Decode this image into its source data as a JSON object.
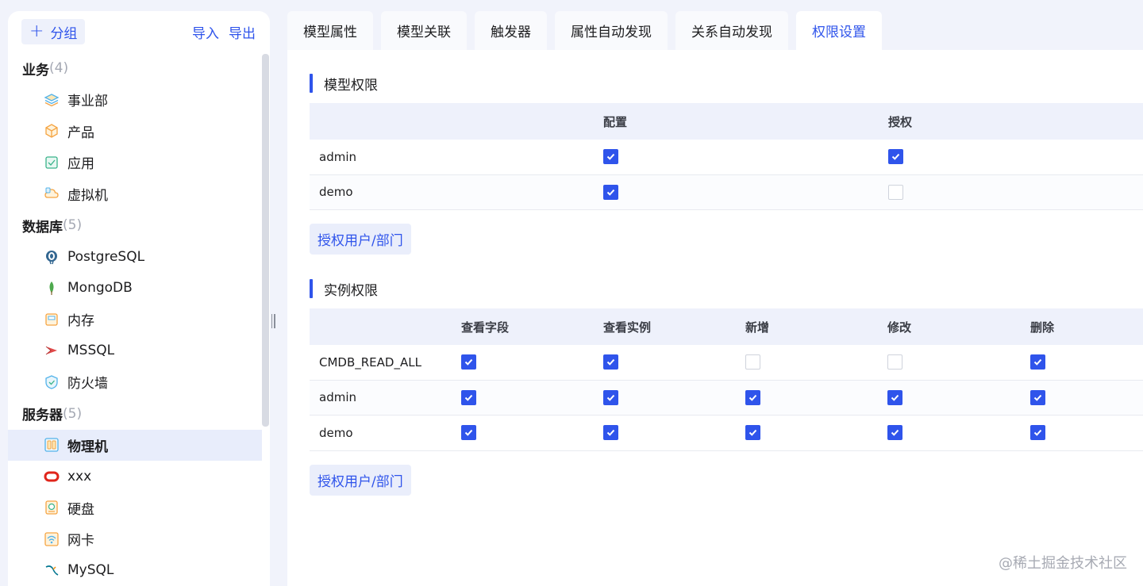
{
  "sidebar": {
    "add_group_label": "分组",
    "import_label": "导入",
    "export_label": "导出",
    "groups": [
      {
        "name": "业务",
        "count": "(4)",
        "items": [
          {
            "label": "事业部",
            "icon": "layers-icon"
          },
          {
            "label": "产品",
            "icon": "cube-icon"
          },
          {
            "label": "应用",
            "icon": "app-window-icon"
          },
          {
            "label": "虚拟机",
            "icon": "cloud-icon"
          }
        ]
      },
      {
        "name": "数据库",
        "count": "(5)",
        "items": [
          {
            "label": "PostgreSQL",
            "icon": "postgresql-icon"
          },
          {
            "label": "MongoDB",
            "icon": "mongodb-leaf-icon"
          },
          {
            "label": "内存",
            "icon": "memory-icon"
          },
          {
            "label": "MSSQL",
            "icon": "mssql-icon"
          },
          {
            "label": "防火墙",
            "icon": "shield-icon"
          }
        ]
      },
      {
        "name": "服务器",
        "count": "(5)",
        "items": [
          {
            "label": "物理机",
            "icon": "server-icon",
            "active": true
          },
          {
            "label": "xxx",
            "icon": "oracle-ring-icon"
          },
          {
            "label": "硬盘",
            "icon": "disk-icon"
          },
          {
            "label": "网卡",
            "icon": "wifi-card-icon"
          },
          {
            "label": "MySQL",
            "icon": "mysql-dolphin-icon"
          }
        ]
      }
    ]
  },
  "tabs": [
    {
      "label": "模型属性"
    },
    {
      "label": "模型关联"
    },
    {
      "label": "触发器"
    },
    {
      "label": "属性自动发现"
    },
    {
      "label": "关系自动发现"
    },
    {
      "label": "权限设置",
      "active": true
    }
  ],
  "model_permissions": {
    "title": "模型权限",
    "columns": [
      "配置",
      "授权"
    ],
    "rows": [
      {
        "name": "admin",
        "values": [
          true,
          true
        ]
      },
      {
        "name": "demo",
        "values": [
          true,
          false
        ]
      }
    ],
    "grant_button": "授权用户/部门"
  },
  "instance_permissions": {
    "title": "实例权限",
    "columns": [
      "查看字段",
      "查看实例",
      "新增",
      "修改",
      "删除"
    ],
    "rows": [
      {
        "name": "CMDB_READ_ALL",
        "values": [
          true,
          true,
          false,
          false,
          true
        ]
      },
      {
        "name": "admin",
        "values": [
          true,
          true,
          true,
          true,
          true
        ]
      },
      {
        "name": "demo",
        "values": [
          true,
          true,
          true,
          true,
          true
        ]
      }
    ],
    "grant_button": "授权用户/部门"
  },
  "watermark": "@稀土掘金技术社区",
  "colors": {
    "accent": "#2f54eb",
    "background": "#f1f3fb",
    "header_bg": "#eef1fb"
  }
}
